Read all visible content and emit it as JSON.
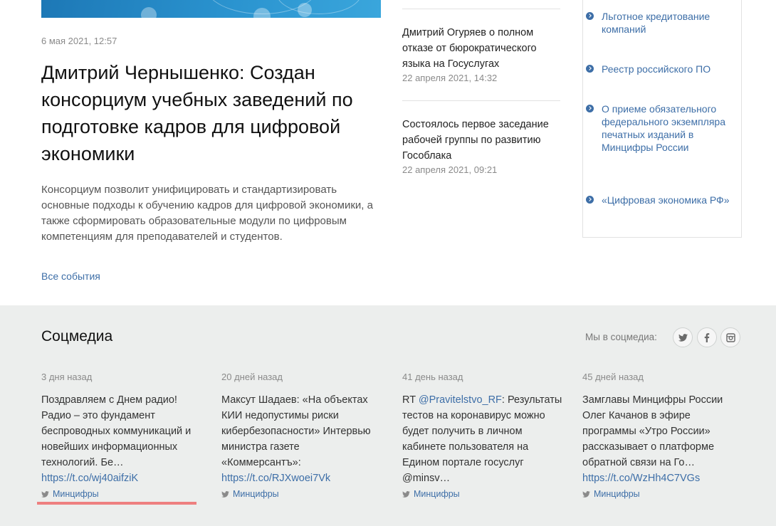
{
  "main_news": {
    "date": "6 мая 2021, 12:57",
    "title": "Дмитрий Чернышенко: Создан консорциум учебных заведений по подготовке кадров для цифровой экономики",
    "lead": "Консорциум позволит унифицировать и стандартизировать основные подходы к обучению кадров для цифровой экономики, а также сформировать образовательные модули по цифровым компетенциям для преподавателей и студентов.",
    "all_events_label": "Все события"
  },
  "news_list": [
    {
      "title": "Дмитрий Огуряев о полном отказе от бюрократического языка на Госуслугах",
      "date": "22 апреля 2021, 14:32"
    },
    {
      "title": "Состоялось первое заседание рабочей группы по развитию Гособлака",
      "date": "22 апреля 2021, 09:21"
    }
  ],
  "side_links": [
    "Льготное кредитование компаний",
    "Реестр российского ПО",
    "О приеме обязательного федерального экземпляра печатных изданий в Минцифры России",
    "«Цифровая экономика РФ»"
  ],
  "social": {
    "title": "Соцмедиа",
    "we_label": "Мы в соцмедиа:",
    "icons": [
      "twitter-icon",
      "facebook-icon",
      "instagram-icon"
    ],
    "posts": [
      {
        "ago": "3 дня назад",
        "text": "Поздравляем с Днем радио! Радио – это фундамент беспроводных коммуникаций и новейших информационных технологий. Бе…",
        "link": "https://t.co/wj40aifziK",
        "author": "Минцифры"
      },
      {
        "ago": "20 дней назад",
        "text": "Максут Шадаев: «На объектах КИИ недопустимы риски кибербезопасности» Интервью министра газете «Коммерсантъ»:",
        "link": "https://t.co/RJXwoei7Vk",
        "author": "Минцифры"
      },
      {
        "ago": "41 день назад",
        "text_prefix": "RT ",
        "mention": "@Pravitelstvo_RF",
        "text": ": Результаты тестов на коронавирус можно будет получить в личном кабинете пользователя на Едином портале госуслуг @minsv…",
        "author": "Минцифры"
      },
      {
        "ago": "45 дней назад",
        "text": "Замглавы Минцифры России Олег Качанов в эфире программы «Утро России» рассказывает о платформе обратной связи на Го…",
        "link": "https://t.co/WzHh4C7VGs",
        "author": "Минцифры"
      }
    ]
  },
  "colors": {
    "link": "#3d6ea7",
    "social_bg": "#eceeed",
    "highlight": "#ee8080"
  }
}
